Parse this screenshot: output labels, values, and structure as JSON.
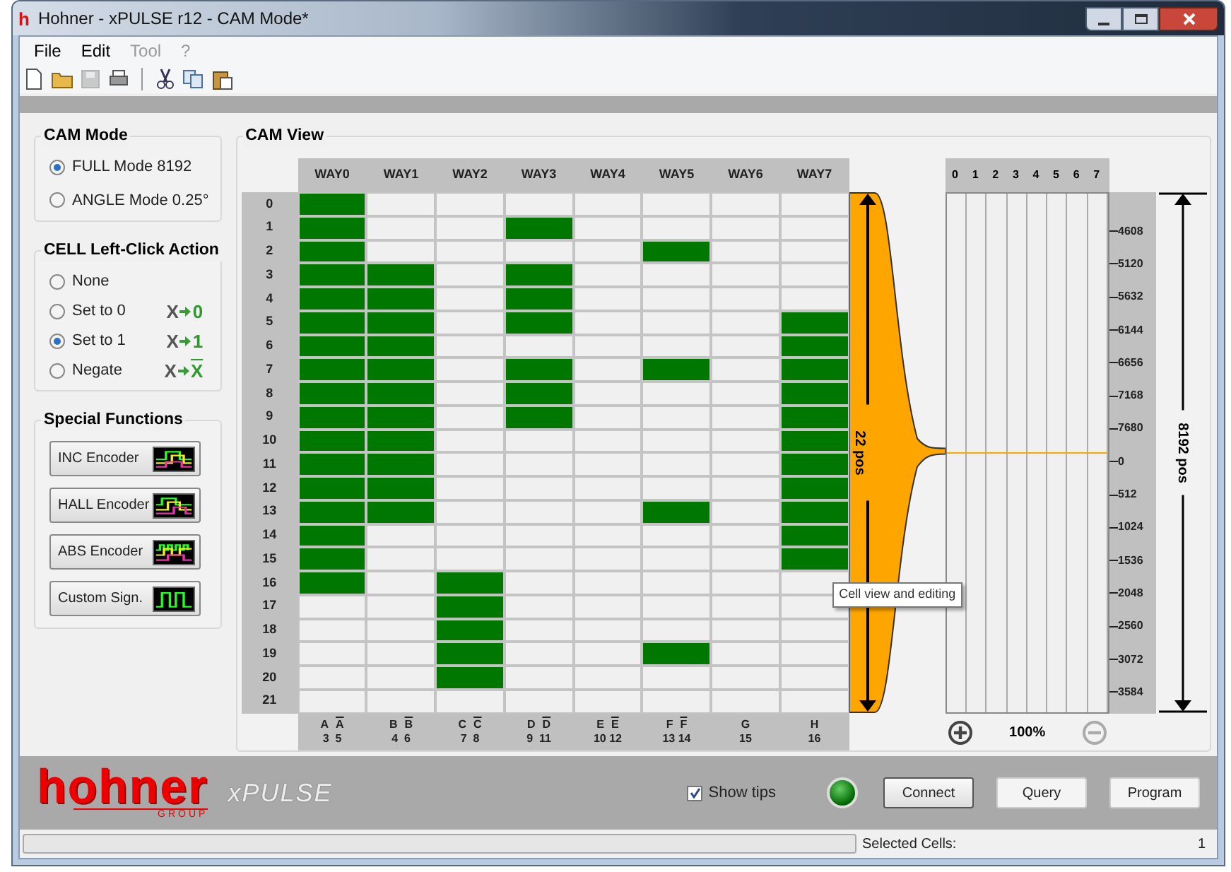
{
  "window": {
    "title": "Hohner - xPULSE r12 - CAM Mode*",
    "app_icon": "h"
  },
  "menu": [
    {
      "label": "File",
      "disabled": false
    },
    {
      "label": "Edit",
      "disabled": false
    },
    {
      "label": "Tool",
      "disabled": true
    },
    {
      "label": "?",
      "disabled": true
    }
  ],
  "toolbar": [
    {
      "kind": "new",
      "disabled": false
    },
    {
      "kind": "open",
      "disabled": false
    },
    {
      "kind": "save",
      "disabled": true
    },
    {
      "kind": "print",
      "disabled": false
    },
    {
      "kind": "separator",
      "disabled": false
    },
    {
      "kind": "cut",
      "disabled": false
    },
    {
      "kind": "copy",
      "disabled": false
    },
    {
      "kind": "paste",
      "disabled": false
    }
  ],
  "cam_mode": {
    "title": "CAM Mode",
    "options": [
      {
        "label": "FULL Mode 8192",
        "selected": true
      },
      {
        "label": "ANGLE Mode 0.25°",
        "selected": false
      }
    ]
  },
  "cell_action": {
    "title": "CELL Left-Click Action",
    "options": [
      {
        "label": "None",
        "selected": false
      },
      {
        "label": "Set to 0",
        "selected": false,
        "formula": {
          "from": "X",
          "to": "0",
          "negated": false
        }
      },
      {
        "label": "Set to 1",
        "selected": true,
        "formula": {
          "from": "X",
          "to": "1",
          "negated": false
        }
      },
      {
        "label": "Negate",
        "selected": false,
        "formula": {
          "from": "X",
          "to": "X",
          "negated": true
        }
      }
    ]
  },
  "special_functions": {
    "title": "Special Functions",
    "buttons": [
      {
        "label": "INC Encoder",
        "kind": "inc"
      },
      {
        "label": "HALL Encoder",
        "kind": "hall"
      },
      {
        "label": "ABS Encoder",
        "kind": "abs"
      },
      {
        "label": "Custom Sign.",
        "kind": "custom"
      }
    ]
  },
  "cam_view": {
    "title": "CAM View",
    "columns": [
      {
        "label": "WAY0",
        "signal": "A",
        "inverted": "A",
        "pins": "3  5"
      },
      {
        "label": "WAY1",
        "signal": "B",
        "inverted": "B",
        "pins": "4  6"
      },
      {
        "label": "WAY2",
        "signal": "C",
        "inverted": "C",
        "pins": "7  8"
      },
      {
        "label": "WAY3",
        "signal": "D",
        "inverted": "D",
        "pins": "9  11"
      },
      {
        "label": "WAY4",
        "signal": "E",
        "inverted": "E",
        "pins": "10 12"
      },
      {
        "label": "WAY5",
        "signal": "F",
        "inverted": "F",
        "pins": "13 14"
      },
      {
        "label": "WAY6",
        "signal": "G",
        "pins": "15"
      },
      {
        "label": "WAY7",
        "signal": "H",
        "pins": "16"
      }
    ],
    "rows": [
      {
        "label": "0",
        "cells": [
          true,
          false,
          false,
          false,
          false,
          false,
          false,
          false
        ]
      },
      {
        "label": "1",
        "cells": [
          true,
          false,
          false,
          true,
          false,
          false,
          false,
          false
        ]
      },
      {
        "label": "2",
        "cells": [
          true,
          false,
          false,
          false,
          false,
          true,
          false,
          false
        ]
      },
      {
        "label": "3",
        "cells": [
          true,
          true,
          false,
          true,
          false,
          false,
          false,
          false
        ]
      },
      {
        "label": "4",
        "cells": [
          true,
          true,
          false,
          true,
          false,
          false,
          false,
          false
        ]
      },
      {
        "label": "5",
        "cells": [
          true,
          true,
          false,
          true,
          false,
          false,
          false,
          true
        ]
      },
      {
        "label": "6",
        "cells": [
          true,
          true,
          false,
          false,
          false,
          false,
          false,
          true
        ]
      },
      {
        "label": "7",
        "cells": [
          true,
          true,
          false,
          true,
          false,
          true,
          false,
          true
        ]
      },
      {
        "label": "8",
        "cells": [
          true,
          true,
          false,
          true,
          false,
          false,
          false,
          true
        ]
      },
      {
        "label": "9",
        "cells": [
          true,
          true,
          false,
          true,
          false,
          false,
          false,
          true
        ]
      },
      {
        "label": "10",
        "cells": [
          true,
          true,
          false,
          false,
          false,
          false,
          false,
          true
        ]
      },
      {
        "label": "11",
        "cells": [
          true,
          true,
          false,
          false,
          false,
          false,
          false,
          true
        ]
      },
      {
        "label": "12",
        "cells": [
          true,
          true,
          false,
          false,
          false,
          false,
          false,
          true
        ]
      },
      {
        "label": "13",
        "cells": [
          true,
          true,
          false,
          false,
          false,
          true,
          false,
          true
        ]
      },
      {
        "label": "14",
        "cells": [
          true,
          false,
          false,
          false,
          false,
          false,
          false,
          true
        ]
      },
      {
        "label": "15",
        "cells": [
          true,
          false,
          false,
          false,
          false,
          false,
          false,
          true
        ]
      },
      {
        "label": "16",
        "cells": [
          true,
          false,
          true,
          false,
          false,
          false,
          false,
          false
        ]
      },
      {
        "label": "17",
        "cells": [
          false,
          false,
          true,
          false,
          false,
          false,
          false,
          false
        ]
      },
      {
        "label": "18",
        "cells": [
          false,
          false,
          true,
          false,
          false,
          false,
          false,
          false
        ]
      },
      {
        "label": "19",
        "cells": [
          false,
          false,
          true,
          false,
          false,
          true,
          false,
          false
        ]
      },
      {
        "label": "20",
        "cells": [
          false,
          false,
          true,
          false,
          false,
          false,
          false,
          false
        ]
      },
      {
        "label": "21",
        "cells": [
          false,
          false,
          false,
          false,
          false,
          false,
          false,
          false
        ]
      }
    ],
    "window_size": "22 pos",
    "overview_columns": [
      "0",
      "1",
      "2",
      "3",
      "4",
      "5",
      "6",
      "7"
    ],
    "scale": [
      "4608",
      "5120",
      "5632",
      "6144",
      "6656",
      "7168",
      "7680",
      "0",
      "512",
      "1024",
      "1536",
      "2048",
      "2560",
      "3072",
      "3584"
    ],
    "total_size": "8192 pos",
    "zoom": "100%",
    "zoom_out_disabled": true,
    "tooltip": "Cell view and editing"
  },
  "footer": {
    "logo": "hohner",
    "logo_sub": "GROUP",
    "product": "xPULSE",
    "show_tips": {
      "label": "Show tips",
      "checked": true
    },
    "connected": true,
    "buttons": [
      {
        "label": "Connect",
        "focused": true
      },
      {
        "label": "Query",
        "focused": false
      },
      {
        "label": "Program",
        "focused": false
      }
    ]
  },
  "status_bar": {
    "progress": {
      "level": 0
    },
    "label": "Selected Cells:",
    "value": "1"
  }
}
